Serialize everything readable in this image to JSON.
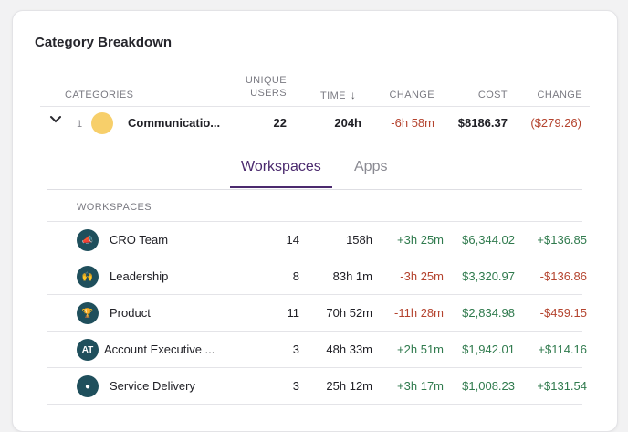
{
  "card": {
    "title": "Category Breakdown"
  },
  "table": {
    "headers": {
      "categories": "CATEGORIES",
      "unique_users_1": "UNIQUE",
      "unique_users_2": "USERS",
      "time": "TIME",
      "change": "CHANGE",
      "cost": "COST",
      "cost_change": "CHANGE"
    },
    "row": {
      "rank": "1",
      "name": "Communicatio...",
      "users": "22",
      "time": "204h",
      "change": "-6h 58m",
      "cost": "$8186.37",
      "cost_change": "($279.26)",
      "dot_color": "#f7cf6a"
    }
  },
  "tabs": [
    {
      "label": "Workspaces",
      "active": true
    },
    {
      "label": "Apps",
      "active": false
    }
  ],
  "workspaces": {
    "header": "WORKSPACES",
    "rows": [
      {
        "icon": "megaphone-icon",
        "glyph": "📣",
        "name": "CRO Team",
        "users": "14",
        "time": "158h",
        "change": "+3h 25m",
        "cost": "$6,344.02",
        "cost_change": "+$136.85"
      },
      {
        "icon": "raised-hands-icon",
        "glyph": "🙌",
        "name": "Leadership",
        "users": "8",
        "time": "83h 1m",
        "change": "-3h 25m",
        "cost": "$3,320.97",
        "cost_change": "-$136.86"
      },
      {
        "icon": "trophy-icon",
        "glyph": "🏆",
        "name": "Product",
        "users": "11",
        "time": "70h 52m",
        "change": "-11h 28m",
        "cost": "$2,834.98",
        "cost_change": "-$459.15"
      },
      {
        "icon": "initials-avatar",
        "glyph": "AT",
        "name": "Account Executive ...",
        "users": "3",
        "time": "48h 33m",
        "change": "+2h 51m",
        "cost": "$1,942.01",
        "cost_change": "+$114.16"
      },
      {
        "icon": "globe-icon",
        "glyph": "●",
        "name": "Service Delivery",
        "users": "3",
        "time": "25h 12m",
        "change": "+3h 17m",
        "cost": "$1,008.23",
        "cost_change": "+$131.54"
      }
    ]
  }
}
